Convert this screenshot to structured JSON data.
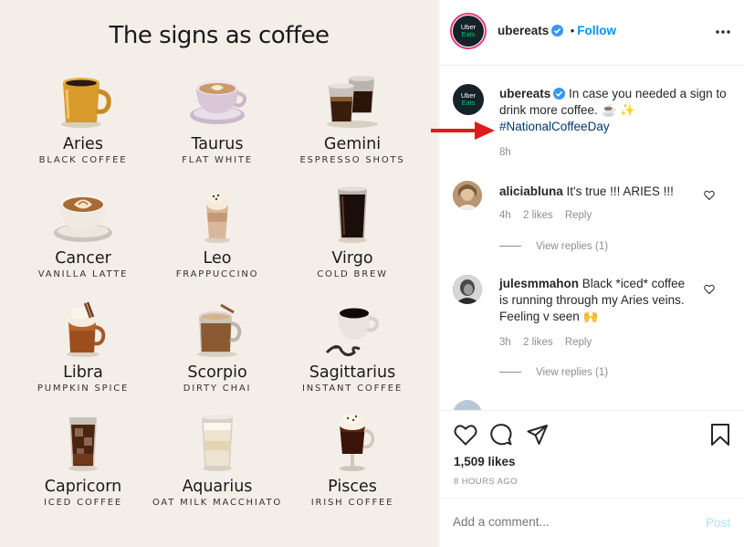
{
  "image": {
    "title": "The signs as coffee",
    "signs": [
      {
        "name": "Aries",
        "coffee": "BLACK COFFEE"
      },
      {
        "name": "Taurus",
        "coffee": "FLAT WHITE"
      },
      {
        "name": "Gemini",
        "coffee": "ESPRESSO SHOTS"
      },
      {
        "name": "Cancer",
        "coffee": "VANILLA LATTE"
      },
      {
        "name": "Leo",
        "coffee": "FRAPPUCCINO"
      },
      {
        "name": "Virgo",
        "coffee": "COLD BREW"
      },
      {
        "name": "Libra",
        "coffee": "PUMPKIN SPICE"
      },
      {
        "name": "Scorpio",
        "coffee": "DIRTY CHAI"
      },
      {
        "name": "Sagittarius",
        "coffee": "INSTANT COFFEE"
      },
      {
        "name": "Capricorn",
        "coffee": "ICED COFFEE"
      },
      {
        "name": "Aquarius",
        "coffee": "OAT MILK MACCHIATO"
      },
      {
        "name": "Pisces",
        "coffee": "IRISH COFFEE"
      }
    ]
  },
  "header": {
    "username": "ubereats",
    "dot": "•",
    "follow": "Follow",
    "avatar_line1": "Uber",
    "avatar_line2": "Eats"
  },
  "caption": {
    "username": "ubereats",
    "text": "In case you needed a sign to drink more coffee. ☕ ✨",
    "hashtag": "#NationalCoffeeDay",
    "time": "8h"
  },
  "comments": [
    {
      "username": "aliciabluna",
      "text": "It's true !!! ARIES !!!",
      "time": "4h",
      "likes": "2 likes",
      "reply": "Reply",
      "view_replies": "View replies (1)"
    },
    {
      "username": "julesmmahon",
      "text": "Black *iced* coffee is running through my Aries veins. Feeling v seen 🙌",
      "time": "3h",
      "likes": "2 likes",
      "reply": "Reply",
      "view_replies": "View replies (1)"
    }
  ],
  "actions": {
    "likes": "1,509 likes",
    "time_ago": "8 HOURS AGO"
  },
  "comment_box": {
    "placeholder": "Add a comment...",
    "post_label": "Post"
  },
  "colors": {
    "accent": "#0095f6",
    "annotation_arrow": "#e01b1b",
    "image_bg": "#f3eee8"
  }
}
